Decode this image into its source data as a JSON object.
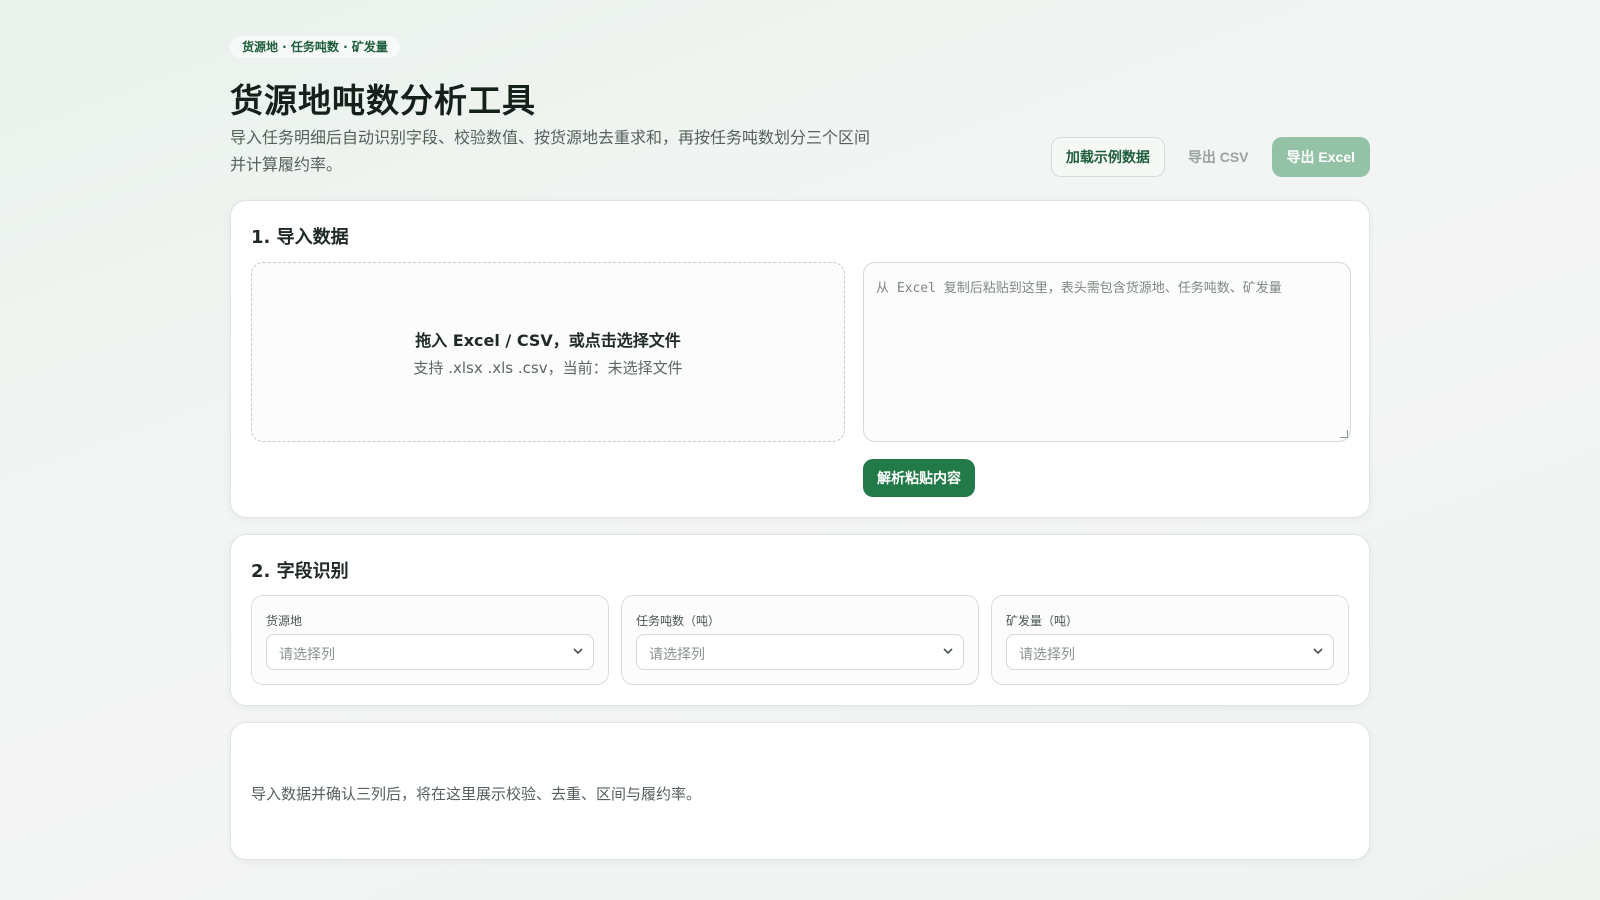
{
  "header": {
    "tag": "货源地 · 任务吨数 · 矿发量",
    "title": "货源地吨数分析工具",
    "subtitle": "导入任务明细后自动识别字段、校验数值、按货源地去重求和，再按任务吨数划分三个区间并计算履约率。"
  },
  "actions": {
    "load_sample": "加载示例数据",
    "export_csv": "导出 CSV",
    "export_excel": "导出 Excel"
  },
  "import_section": {
    "title": "1. 导入数据",
    "dropzone_title": "拖入 Excel / CSV，或点击选择文件",
    "dropzone_sub": "支持 .xlsx .xls .csv，当前：未选择文件",
    "paste_placeholder": "从 Excel 复制后粘贴到这里，表头需包含货源地、任务吨数、矿发量",
    "parse_button": "解析粘贴内容"
  },
  "field_section": {
    "title": "2. 字段识别",
    "fields": [
      {
        "label": "货源地",
        "value": "请选择列"
      },
      {
        "label": "任务吨数（吨）",
        "value": "请选择列"
      },
      {
        "label": "矿发量（吨）",
        "value": "请选择列"
      }
    ]
  },
  "result_section": {
    "empty_text": "导入数据并确认三列后，将在这里展示校验、去重、区间与履约率。"
  },
  "colors": {
    "accent": "#217a48",
    "accent_disabled": "#93c2a7",
    "tag_text": "#1f5e3c"
  },
  "icons": {
    "select_arrow": "chevron-down-icon"
  }
}
